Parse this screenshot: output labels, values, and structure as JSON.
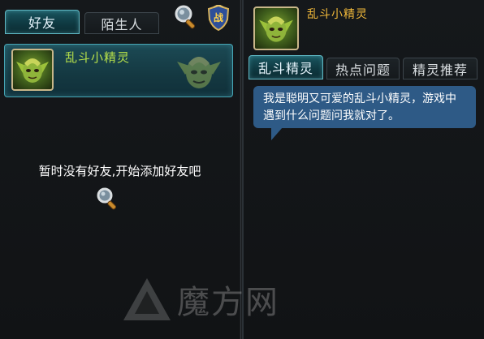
{
  "friends_panel": {
    "tabs": [
      {
        "label": "好友",
        "active": true
      },
      {
        "label": "陌生人",
        "active": false
      }
    ],
    "search_icon": "magnifier-icon",
    "battle_badge": {
      "label": "战",
      "icon": "shield-badge-icon"
    },
    "friend_list": [
      {
        "name": "乱斗小精灵",
        "avatar": "green-elf-avatar"
      }
    ],
    "empty_message": "暂时没有好友,开始添加好友吧",
    "add_friend_icon": "magnifier-icon"
  },
  "detail_panel": {
    "name": "乱斗小精灵",
    "avatar": "green-elf-avatar",
    "tabs": [
      {
        "label": "乱斗精灵",
        "active": true
      },
      {
        "label": "热点问题",
        "active": false
      },
      {
        "label": "精灵推荐",
        "active": false
      }
    ],
    "message": "我是聪明又可爱的乱斗小精灵，游戏中遇到什么问题问我就对了。"
  },
  "watermark": {
    "text": "魔方网"
  },
  "colors": {
    "background": "#121416",
    "active_tab": "#1a5660",
    "friend_name": "#b6e04a",
    "detail_name": "#f0b83a",
    "bubble": "#2e5a86"
  }
}
